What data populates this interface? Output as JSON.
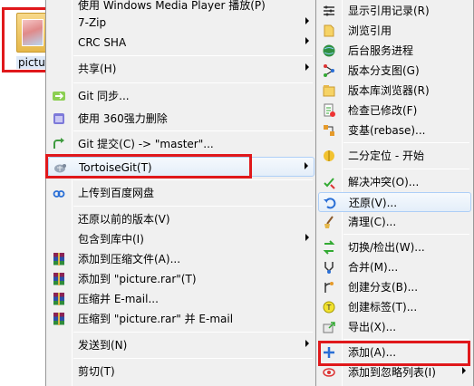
{
  "desktop": {
    "folder_label": "picture"
  },
  "left_menu": {
    "items": [
      {
        "label": "使用 Windows Media Player 播放(P)",
        "icon": "none"
      },
      {
        "label": "7-Zip",
        "icon": "none",
        "submenu": true
      },
      {
        "label": "CRC SHA",
        "icon": "none",
        "submenu": true
      },
      {
        "label": "共享(H)",
        "icon": "none",
        "submenu": true
      },
      {
        "label": "Git 同步...",
        "icon": "git-sync-icon"
      },
      {
        "label": "使用 360强力删除",
        "icon": "360-delete-icon"
      },
      {
        "label": "Git 提交(C) -> \"master\"...",
        "icon": "git-commit-icon"
      },
      {
        "label": "TortoiseGit(T)",
        "icon": "tortoisegit-icon",
        "submenu": true
      },
      {
        "label": "上传到百度网盘",
        "icon": "baidu-cloud-icon"
      },
      {
        "label": "还原以前的版本(V)",
        "icon": "none"
      },
      {
        "label": "包含到库中(I)",
        "icon": "none",
        "submenu": true
      },
      {
        "label": "添加到压缩文件(A)...",
        "icon": "winrar-icon"
      },
      {
        "label": "添加到 \"picture.rar\"(T)",
        "icon": "winrar-icon"
      },
      {
        "label": "压缩并 E-mail...",
        "icon": "winrar-icon"
      },
      {
        "label": "压缩到 \"picture.rar\" 并 E-mail",
        "icon": "winrar-icon"
      },
      {
        "label": "发送到(N)",
        "icon": "none",
        "submenu": true
      },
      {
        "label": "剪切(T)",
        "icon": "none"
      }
    ]
  },
  "right_menu": {
    "items": [
      {
        "label": "显示引用记录(R)",
        "icon": "reflog-icon"
      },
      {
        "label": "浏览引用",
        "icon": "browse-refs-icon"
      },
      {
        "label": "后台服务进程",
        "icon": "daemon-icon"
      },
      {
        "label": "版本分支图(G)",
        "icon": "revision-graph-icon"
      },
      {
        "label": "版本库浏览器(R)",
        "icon": "repo-browser-icon"
      },
      {
        "label": "检查已修改(F)",
        "icon": "check-modifications-icon"
      },
      {
        "label": "变基(rebase)...",
        "icon": "rebase-icon"
      },
      {
        "label": "二分定位 - 开始",
        "icon": "bisect-icon"
      },
      {
        "label": "解决冲突(O)...",
        "icon": "resolve-icon"
      },
      {
        "label": "还原(V)...",
        "icon": "revert-icon"
      },
      {
        "label": "清理(C)...",
        "icon": "cleanup-icon"
      },
      {
        "label": "切换/检出(W)...",
        "icon": "switch-checkout-icon"
      },
      {
        "label": "合并(M)...",
        "icon": "merge-icon"
      },
      {
        "label": "创建分支(B)...",
        "icon": "create-branch-icon"
      },
      {
        "label": "创建标签(T)...",
        "icon": "create-tag-icon"
      },
      {
        "label": "导出(X)...",
        "icon": "export-icon"
      },
      {
        "label": "添加(A)...",
        "icon": "add-icon"
      },
      {
        "label": "添加到忽略列表(I)",
        "icon": "ignore-icon",
        "submenu": true
      }
    ]
  },
  "colors": {
    "highlight_border": "#e0181b",
    "menu_background": "#f0f0f0",
    "hover_border": "#aecff7"
  }
}
